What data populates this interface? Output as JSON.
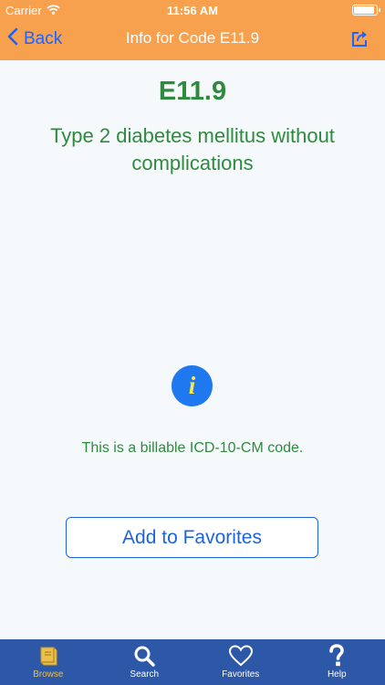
{
  "status_bar": {
    "carrier": "Carrier",
    "time": "11:56 AM",
    "icons": [
      "wifi-icon",
      "battery-icon"
    ]
  },
  "nav": {
    "back_label": "Back",
    "title": "Info for Code E11.9",
    "share_icon": "share-icon"
  },
  "content": {
    "code": "E11.9",
    "description": "Type 2 diabetes mellitus without complications",
    "info_glyph": "i",
    "billable_text": "This is a billable ICD-10-CM code.",
    "favorites_button": "Add to Favorites"
  },
  "tabs": [
    {
      "label": "Browse",
      "icon": "book-icon",
      "active": true
    },
    {
      "label": "Search",
      "icon": "search-icon",
      "active": false
    },
    {
      "label": "Favorites",
      "icon": "heart-icon",
      "active": false
    },
    {
      "label": "Help",
      "icon": "question-icon",
      "active": false
    }
  ],
  "colors": {
    "nav_bar": "#f7a14f",
    "accent_blue": "#1d63e0",
    "text_green": "#2e8b3e",
    "tab_bar": "#2d57a7",
    "tab_active": "#e9c04a",
    "info_circle": "#1f78f0",
    "info_glyph": "#ffe93b"
  }
}
